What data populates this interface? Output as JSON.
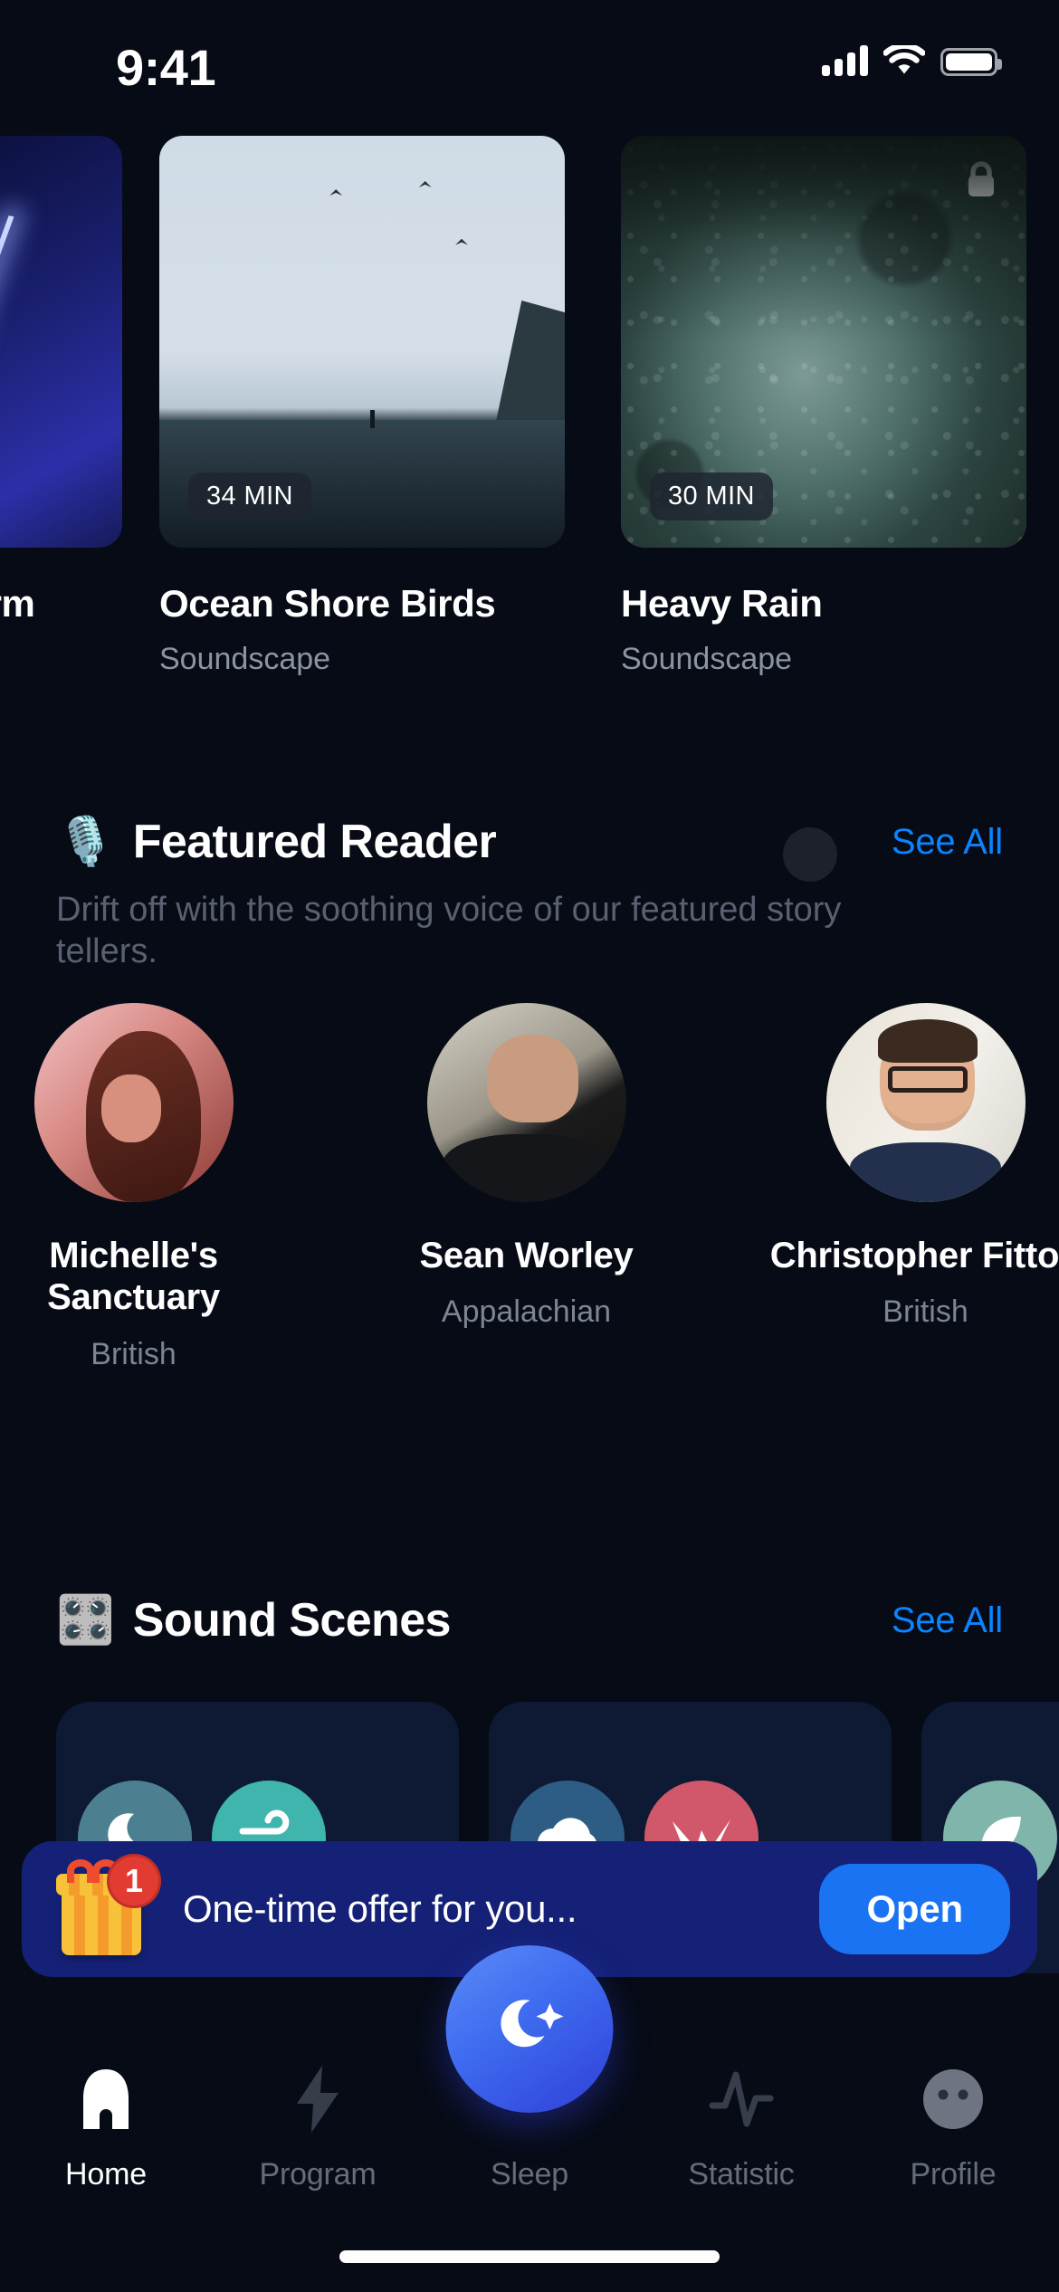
{
  "status_bar": {
    "time": "9:41",
    "signal_icon": "signal-bars-icon",
    "wifi_icon": "wifi-icon",
    "battery_icon": "battery-full-icon"
  },
  "soundscapes": {
    "items": [
      {
        "title": "...storm",
        "subtitle": "",
        "duration": "",
        "locked": false,
        "art": "art-storm"
      },
      {
        "title": "Ocean Shore Birds",
        "subtitle": "Soundscape",
        "duration": "34 MIN",
        "locked": false,
        "art": "art-ocean"
      },
      {
        "title": "Heavy Rain",
        "subtitle": "Soundscape",
        "duration": "30 MIN",
        "locked": true,
        "art": "art-rain"
      }
    ]
  },
  "featured_reader": {
    "emoji": "🎙️",
    "title": "Featured Reader",
    "see_all": "See All",
    "description": "Drift off with the soothing voice of our featured story tellers.",
    "readers": [
      {
        "name": "Michelle's Sanctuary",
        "accent": "British"
      },
      {
        "name": "Sean Worley",
        "accent": "Appalachian"
      },
      {
        "name": "Christopher Fitton",
        "accent": "British"
      }
    ]
  },
  "sound_scenes": {
    "emoji": "🎛️",
    "title": "Sound Scenes",
    "see_all": "See All",
    "icons": [
      {
        "name": "moon-icon",
        "color": "#4c8090"
      },
      {
        "name": "wind-icon",
        "color": "#3fb5ad"
      },
      {
        "name": "cloud-icon",
        "color": "#2d5c84"
      },
      {
        "name": "bird-icon",
        "color": "#d0586a"
      },
      {
        "name": "leaf-icon",
        "color": "#7fb5ab"
      }
    ]
  },
  "promo_banner": {
    "gift_icon": "gift-icon",
    "badge_count": "1",
    "text": "One-time offer for you...",
    "button_label": "Open",
    "background_color": "#152176",
    "button_color": "#1a73f2"
  },
  "tab_bar": {
    "items": [
      {
        "label": "Home",
        "icon": "home-icon",
        "active": true
      },
      {
        "label": "Program",
        "icon": "bolt-icon",
        "active": false
      },
      {
        "label": "Sleep",
        "icon": "moon-star-icon",
        "active": false
      },
      {
        "label": "Statistic",
        "icon": "pulse-icon",
        "active": false
      },
      {
        "label": "Profile",
        "icon": "face-icon",
        "active": false
      }
    ],
    "accent_color": "#3f6df0"
  }
}
